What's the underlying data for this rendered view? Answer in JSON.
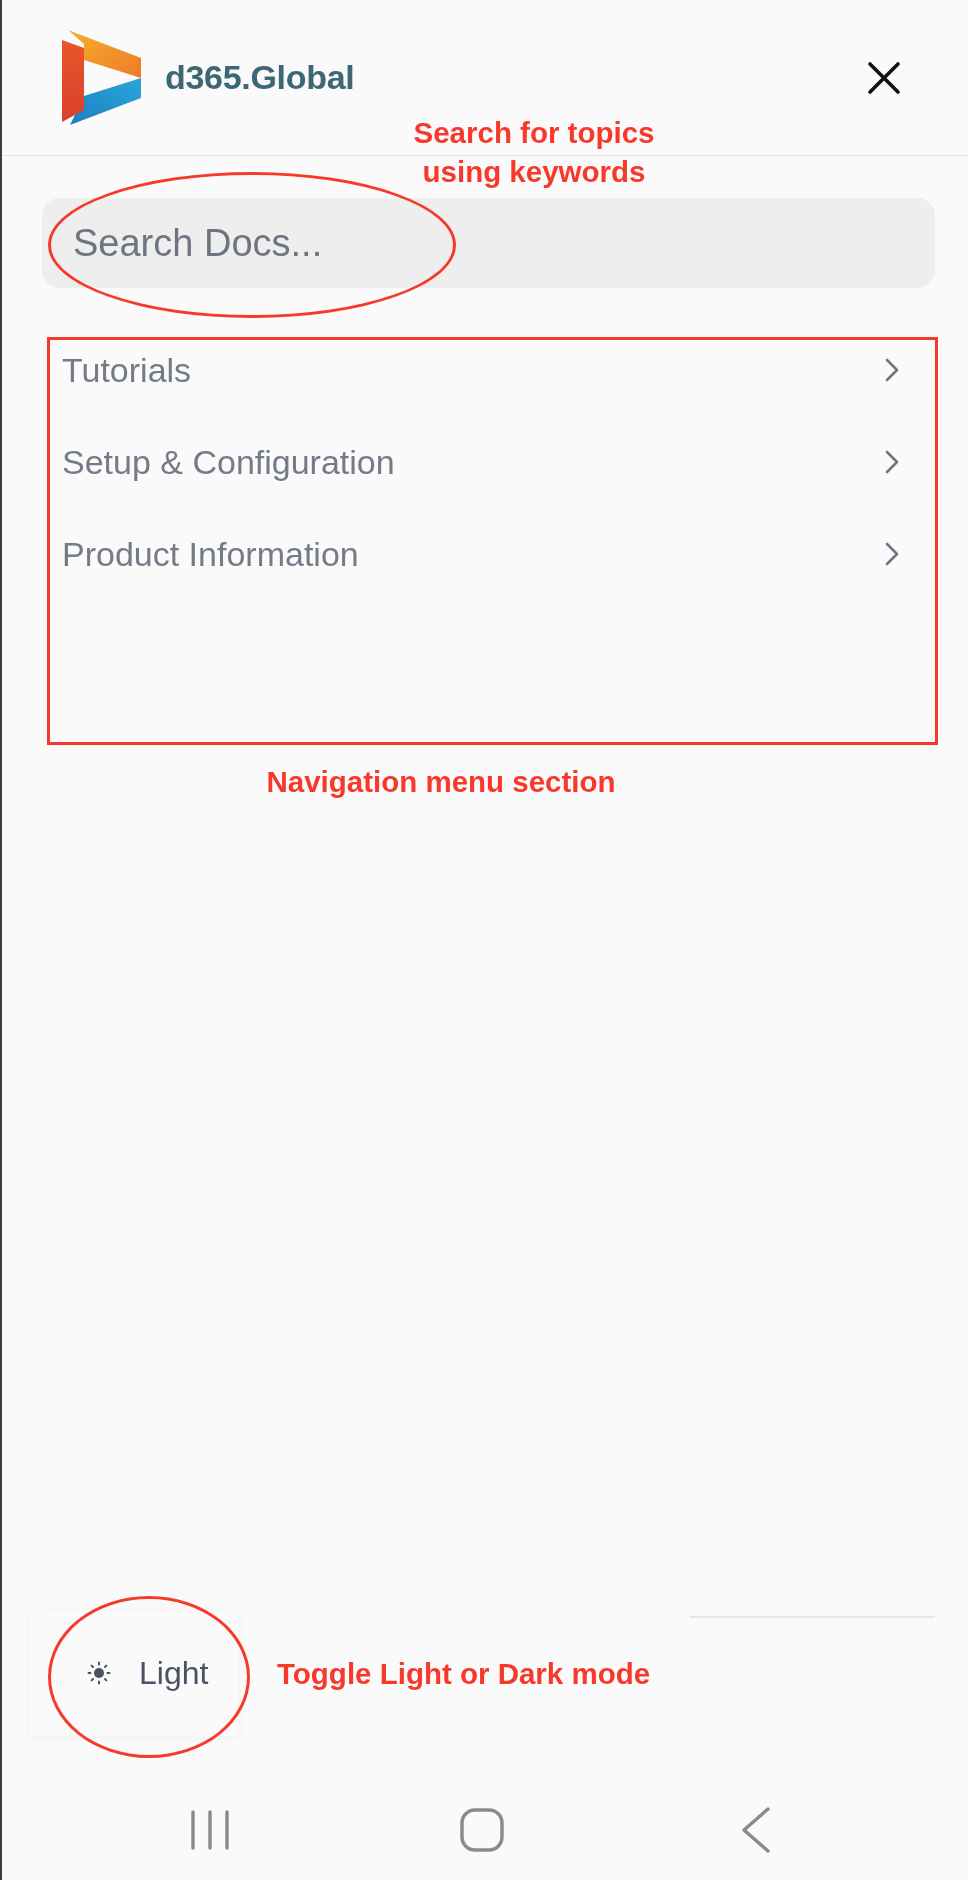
{
  "header": {
    "logo_text": "d365.Global"
  },
  "search": {
    "placeholder": "Search Docs...",
    "callout": {
      "kind": "ellipse",
      "note": "Search for topics using keywords"
    }
  },
  "nav": {
    "items": [
      {
        "label": "Tutorials"
      },
      {
        "label": "Setup & Configuration"
      },
      {
        "label": "Product Information"
      }
    ],
    "callout": {
      "kind": "rectangle",
      "note": "Navigation menu section"
    }
  },
  "theme_toggle": {
    "label": "Light",
    "callout": {
      "kind": "ellipse",
      "note": "Toggle Light or Dark mode"
    }
  }
}
